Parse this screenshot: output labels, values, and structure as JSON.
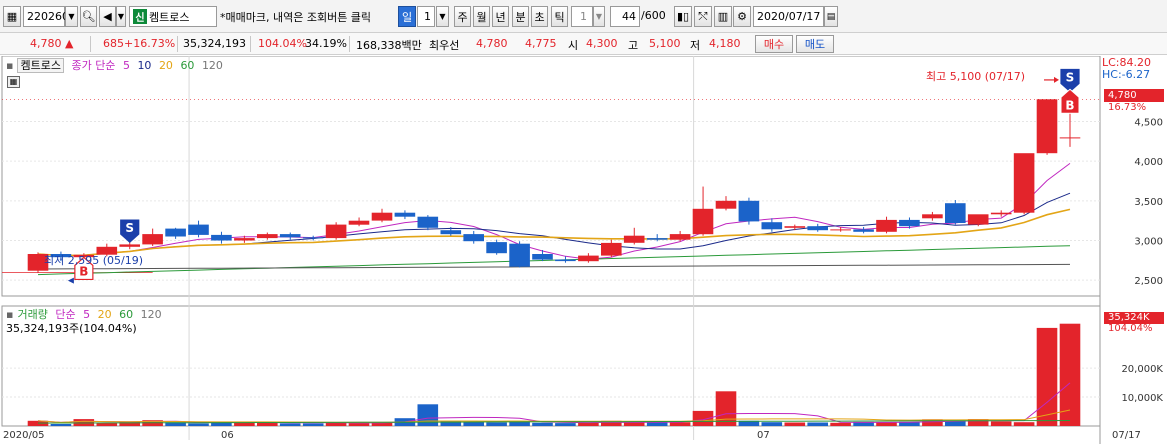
{
  "toolbar": {
    "stock_code": "220260",
    "stock_name": "켐트로스",
    "sin_badge": "신",
    "notice": "*매매마크, 내역은 조회버튼 클릭",
    "period_il": "일",
    "period_value": "1",
    "period_ju": "주",
    "period_wol": "월",
    "period_nyeon": "년",
    "period_bun": "분",
    "period_cho": "초",
    "period_tik": "틱",
    "tick_value": "1",
    "count_value": "44",
    "count_total": "/600",
    "date_value": "2020/07/17"
  },
  "quote": {
    "price": "4,780",
    "change": "685",
    "change_pct": "+16.73%",
    "volume": "35,324,193",
    "volume_ratio": "104.04%",
    "turnover": "34.19%",
    "amount": "168,338백만",
    "best_label": "최우선",
    "best_ask": "4,780",
    "best_bid": "4,775",
    "open_label": "시",
    "open": "4,300",
    "high_label": "고",
    "high": "5,100",
    "low_label": "저",
    "low": "4,180",
    "buy_label": "매수",
    "sell_label": "매도"
  },
  "price_panel": {
    "name": "켐트로스",
    "legend_label": "종가 단순",
    "ma": [
      "5",
      "10",
      "20",
      "60",
      "120"
    ],
    "lc": "LC:84.20",
    "hc": "HC:-6.27",
    "last_price": "4,780",
    "last_pct": "16.73%",
    "high_note": "최고 5,100 (07/17)",
    "low_note": "최저 2,595 (05/19)",
    "y_ticks": [
      "4,500",
      "4,000",
      "3,500",
      "3,000",
      "2,500"
    ]
  },
  "volume_panel": {
    "name": "거래량",
    "legend_label": "단순",
    "ma": [
      "5",
      "20",
      "60",
      "120"
    ],
    "volume_text": "35,324,193주(104.04%)",
    "last_value": "35,324K",
    "last_pct": "104.04%",
    "y_ticks": [
      "20,000K",
      "10,000K"
    ]
  },
  "x_labels": [
    "2020/05",
    "06",
    "07",
    "07/17"
  ],
  "colors": {
    "up": "#e3242b",
    "down": "#1b63c9",
    "ma5": "#c028c0",
    "ma10": "#1b2a8a",
    "ma20": "#e3a516",
    "ma60": "#2b9a3a",
    "ma120": "#555555"
  },
  "chart_data": {
    "type": "candlestick",
    "x": [
      "05/15",
      "05/18",
      "05/19",
      "05/20",
      "05/21",
      "05/22",
      "05/25",
      "05/26",
      "05/27",
      "05/28",
      "05/29",
      "06/01",
      "06/02",
      "06/03",
      "06/04",
      "06/05",
      "06/08",
      "06/09",
      "06/10",
      "06/11",
      "06/12",
      "06/15",
      "06/16",
      "06/17",
      "06/18",
      "06/19",
      "06/22",
      "06/23",
      "06/24",
      "06/25",
      "06/26",
      "06/29",
      "06/30",
      "07/01",
      "07/02",
      "07/03",
      "07/06",
      "07/07",
      "07/08",
      "07/09",
      "07/10",
      "07/13",
      "07/14",
      "07/15",
      "07/16",
      "07/17"
    ],
    "open": [
      2620,
      2830,
      2790,
      2820,
      2920,
      2950,
      3150,
      3200,
      3070,
      3000,
      3030,
      3080,
      3040,
      3030,
      3200,
      3250,
      3350,
      3300,
      3130,
      3080,
      2980,
      2960,
      2830,
      2760,
      2740,
      2810,
      2970,
      3030,
      3010,
      3080,
      3400,
      3500,
      3230,
      3160,
      3180,
      3130,
      3140,
      3110,
      3260,
      3280,
      3470,
      3200,
      3330,
      3350,
      4100,
      4300
    ],
    "close": [
      2830,
      2790,
      2820,
      2920,
      2950,
      3080,
      3050,
      3070,
      3000,
      3030,
      3080,
      3040,
      3030,
      3200,
      3250,
      3350,
      3300,
      3160,
      3080,
      2990,
      2840,
      2670,
      2760,
      2740,
      2810,
      2970,
      3060,
      3010,
      3080,
      3400,
      3500,
      3240,
      3140,
      3180,
      3130,
      3140,
      3110,
      3260,
      3180,
      3330,
      3220,
      3330,
      3350,
      4100,
      4780,
      4300
    ],
    "high": [
      2850,
      2860,
      2840,
      2960,
      2980,
      3150,
      3160,
      3250,
      3110,
      3060,
      3100,
      3100,
      3060,
      3230,
      3290,
      3400,
      3380,
      3320,
      3170,
      3120,
      3010,
      2990,
      2880,
      2800,
      2840,
      3010,
      3160,
      3080,
      3120,
      3680,
      3560,
      3540,
      3280,
      3200,
      3210,
      3170,
      3170,
      3300,
      3290,
      3360,
      3510,
      3250,
      3380,
      3450,
      4320,
      4620
    ],
    "low": [
      2595,
      2740,
      2740,
      2800,
      2890,
      2930,
      3020,
      3040,
      2960,
      2970,
      3010,
      3010,
      3000,
      3010,
      3180,
      3230,
      3270,
      3130,
      3060,
      2960,
      2820,
      2660,
      2740,
      2720,
      2720,
      2790,
      2950,
      2990,
      2990,
      3060,
      3380,
      3200,
      3110,
      3130,
      3110,
      3110,
      3090,
      3090,
      3150,
      3250,
      3200,
      3180,
      3300,
      3330,
      4080,
      4180
    ],
    "volume": [
      1800,
      700,
      2400,
      1200,
      1400,
      2000,
      1300,
      900,
      1100,
      1500,
      1300,
      900,
      900,
      1200,
      1000,
      1300,
      2700,
      7500,
      1900,
      1400,
      1200,
      1500,
      1100,
      1000,
      1100,
      1800,
      1300,
      1300,
      1300,
      5200,
      12000,
      1800,
      1300,
      1200,
      1200,
      1100,
      1400,
      1300,
      1400,
      2300,
      1700,
      2400,
      1600,
      1300,
      33900,
      35324
    ],
    "ylim": [
      2300,
      5200
    ],
    "volume_ylim": [
      0,
      38000
    ]
  }
}
